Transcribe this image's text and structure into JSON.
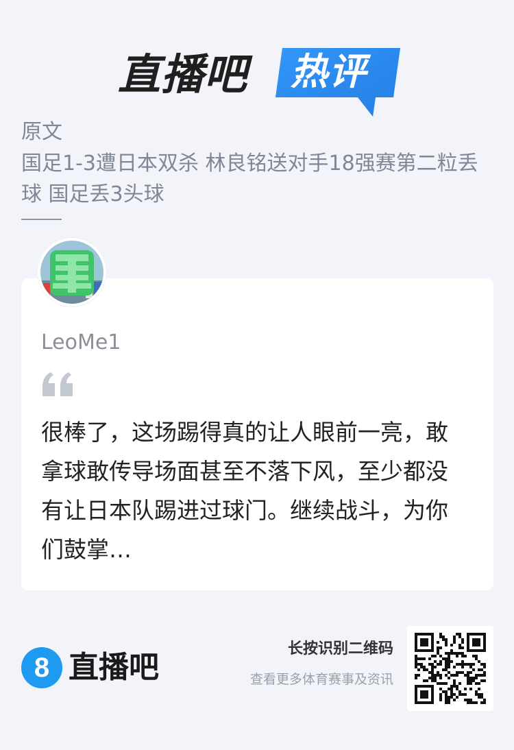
{
  "header": {
    "brand": "直播吧",
    "badge": "热评",
    "brand_color": "#1f1f1f",
    "badge_color": "#2b8cf0"
  },
  "article": {
    "label": "原文",
    "title": "国足1-3遭日本双杀 林良铭送对手18强赛第二粒丢球 国足丢3头球"
  },
  "comment": {
    "username": "LeoMe1",
    "quote_icon": "quote-icon",
    "text": "很棒了，这场踢得真的让人眼前一亮，敢拿球敢传导场面甚至不落下风，至少都没有让日本队踢进过球门。继续战斗，为你们鼓掌…",
    "avatar_icon": "avatar-image"
  },
  "footer": {
    "logo_number": "8",
    "brand": "直播吧",
    "qr_title": "长按识别二维码",
    "qr_subtitle": "查看更多体育赛事及资讯",
    "accent_color": "#1e9bf0"
  }
}
